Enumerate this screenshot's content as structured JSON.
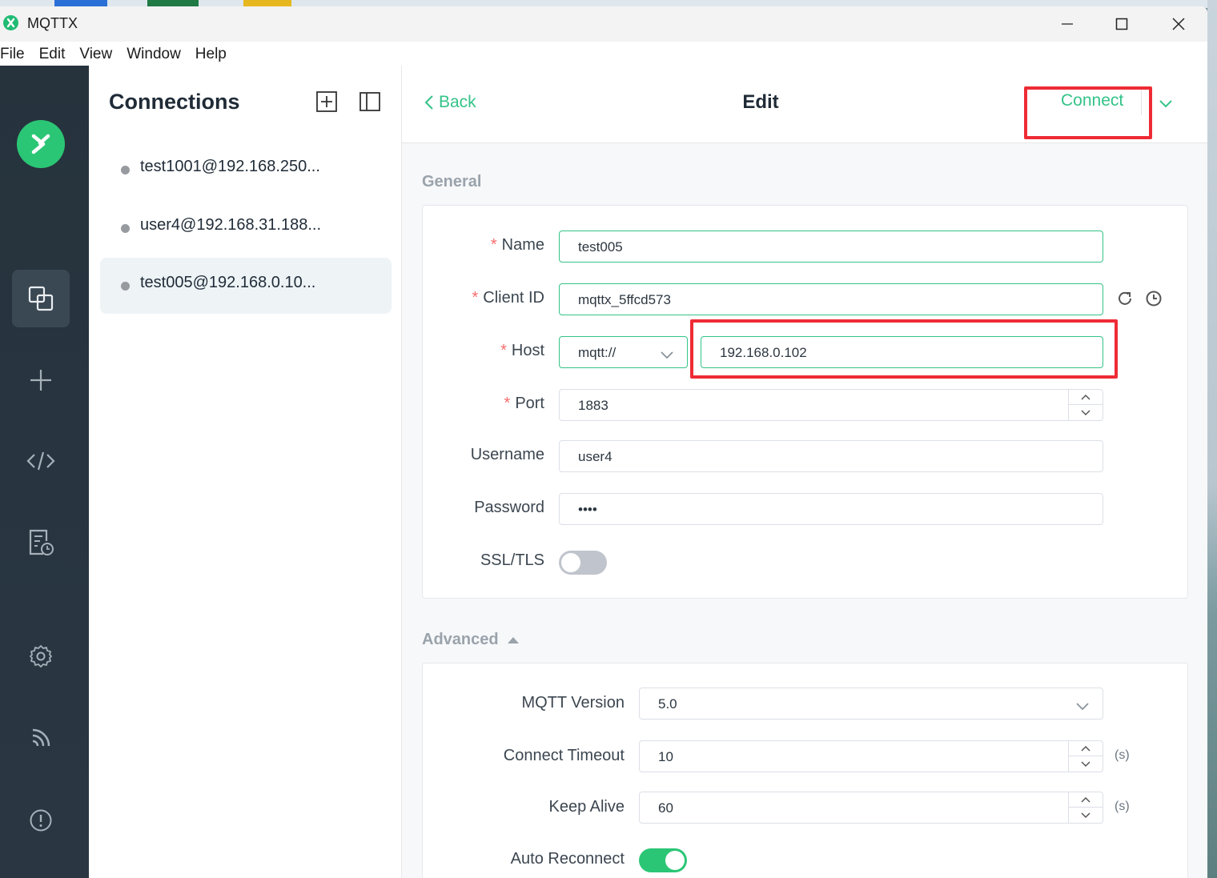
{
  "window": {
    "title": "MQTTX"
  },
  "menu": [
    "File",
    "Edit",
    "View",
    "Window",
    "Help"
  ],
  "sidebar": {
    "items": [
      {
        "name": "connections-icon",
        "active": true
      },
      {
        "name": "plus-icon"
      },
      {
        "name": "code-icon"
      },
      {
        "name": "log-icon"
      },
      {
        "name": "gear-icon"
      },
      {
        "name": "rss-icon"
      },
      {
        "name": "info-icon"
      }
    ]
  },
  "connections": {
    "title": "Connections",
    "items": [
      {
        "label": "test1001@192.168.250..."
      },
      {
        "label": "user4@192.168.31.188..."
      },
      {
        "label": "test005@192.168.0.10..."
      }
    ]
  },
  "header": {
    "back_label": "Back",
    "title": "Edit",
    "connect_label": "Connect"
  },
  "general": {
    "section_label": "General",
    "name_label": "Name",
    "name_value": "test005",
    "client_id_label": "Client ID",
    "client_id_value": "mqttx_5ffcd573",
    "host_label": "Host",
    "protocol_value": "mqtt://",
    "host_value": "192.168.0.102",
    "port_label": "Port",
    "port_value": "1883",
    "username_label": "Username",
    "username_value": "user4",
    "password_label": "Password",
    "password_value": "••••",
    "ssl_label": "SSL/TLS",
    "ssl_enabled": false
  },
  "advanced": {
    "section_label": "Advanced",
    "mqtt_version_label": "MQTT Version",
    "mqtt_version_value": "5.0",
    "connect_timeout_label": "Connect Timeout",
    "connect_timeout_value": "10",
    "connect_timeout_unit": "(s)",
    "keep_alive_label": "Keep Alive",
    "keep_alive_value": "60",
    "keep_alive_unit": "(s)",
    "auto_reconnect_label": "Auto Reconnect",
    "auto_reconnect_enabled": true
  },
  "colors": {
    "accent": "#34c388",
    "highlight": "#ee2b35",
    "sidebar_bg": "#26333d"
  }
}
